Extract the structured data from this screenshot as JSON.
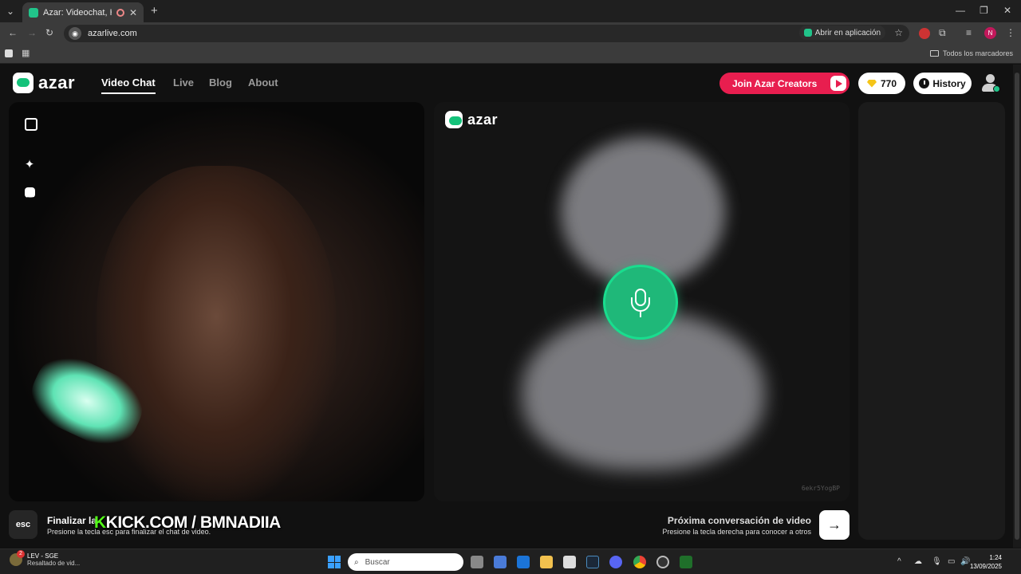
{
  "browser": {
    "tab_title": "Azar: Videochat, Haz nuevo...",
    "url": "azarlive.com",
    "open_in_app": "Abrir en aplicación",
    "bookmarks_label": "Todos los marcadores",
    "profile_initial": "N"
  },
  "header": {
    "logo_text": "azar",
    "nav": [
      "Video Chat",
      "Live",
      "Blog",
      "About"
    ],
    "creators_button": "Join Azar Creators",
    "gems_count": "770",
    "history_button": "History"
  },
  "remote": {
    "logo_text": "azar",
    "id": "6ekr5YogBP"
  },
  "bottom": {
    "esc_key": "esc",
    "end_title": "Finalizar la",
    "end_sub": "Presione la tecla esc para finalizar el chat de video.",
    "kick_k": "K",
    "kick_rest": "KICK.COM / BMNADIIA",
    "next_title": "Próxima conversación de video",
    "next_sub": "Presione la tecla derecha para conocer a otros",
    "next_arrow": "→"
  },
  "taskbar": {
    "weather_title": "LEV - SGE",
    "weather_sub": "Resaltado de vid...",
    "weather_badge": "2",
    "search_placeholder": "Buscar",
    "time": "1:24",
    "date": "13/09/2025"
  },
  "colors": {
    "brand_green": "#1fb879",
    "creators_red": "#e81e4f",
    "kick_green": "#53fc18"
  }
}
